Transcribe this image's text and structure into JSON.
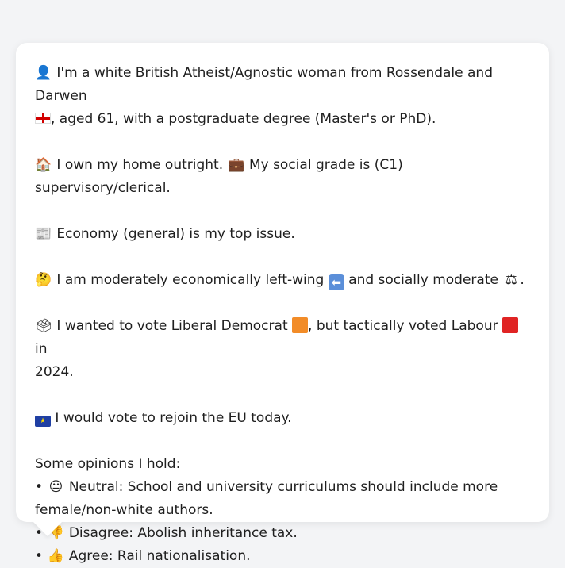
{
  "card": {
    "identity": {
      "icon": "person-silhouette-icon",
      "line1": "I'm a white British Atheist/Agnostic woman from Rossendale and Darwen",
      "flag_icon": "england-flag-icon",
      "line2": ", aged 61, with a postgraduate degree (Master's or PhD)."
    },
    "home": {
      "icon": "house-icon",
      "text1": "I own my home outright.",
      "briefcase_icon": "briefcase-icon",
      "text2": "My social grade is (C1) supervisory/clerical."
    },
    "issue": {
      "icon": "newspaper-icon",
      "text": "Economy (general) is my top issue."
    },
    "position": {
      "icon": "thinking-face-icon",
      "text1": "I am moderately economically left-wing",
      "left_arrow_icon": "left-arrow-icon",
      "text2": "and socially moderate",
      "scales_icon": "balance-scale-icon",
      "text3": "."
    },
    "vote": {
      "icon": "ballot-box-icon",
      "text1": "I wanted to vote Liberal Democrat",
      "libdem_color": "#f28c28",
      "text2": ", but tactically voted Labour",
      "labour_color": "#e02424",
      "text3": "in",
      "text4": "2024."
    },
    "eu": {
      "icon": "eu-flag-icon",
      "text": "I would vote to rejoin the EU today."
    },
    "opinions": {
      "heading": "Some opinions I hold:",
      "items": [
        {
          "bullet": "•",
          "icon": "neutral-face-icon",
          "line1": "Neutral: School and university curriculums should include more",
          "line2": "female/non-white authors."
        },
        {
          "bullet": "•",
          "icon": "thumbs-down-icon",
          "line1": "Disagree: Abolish inheritance tax."
        },
        {
          "bullet": "•",
          "icon": "thumbs-up-icon",
          "line1": "Agree: Rail nationalisation."
        }
      ]
    }
  }
}
